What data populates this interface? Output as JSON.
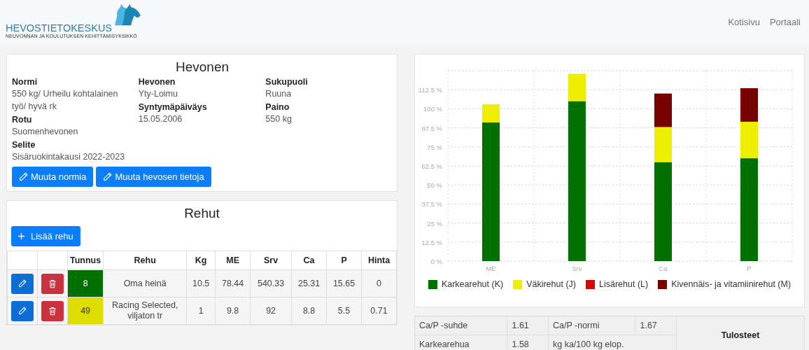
{
  "header": {
    "logo_title": "HEVOSTIETOKESKUS",
    "logo_subtitle": "NEUVONNAN JA KOULUTUKSEN KEHITTÄMISYKSIKKÖ",
    "nav": [
      "Kotisivu",
      "Portaali"
    ]
  },
  "horse": {
    "title": "Hevonen",
    "columns": [
      [
        {
          "label": "Normi",
          "value": "550 kg/ Urheilu kohtalainen työ/ hyvä rk"
        },
        {
          "label": "Rotu",
          "value": "Suomenhevonen"
        },
        {
          "label": "Selite",
          "value": "Sisäruokintakausi 2022-2023"
        }
      ],
      [
        {
          "label": "Hevonen",
          "value": "Yty-Loimu"
        },
        {
          "label": "Syntymäpäiväys",
          "value": "15.05.2006"
        }
      ],
      [
        {
          "label": "Sukupuoli",
          "value": "Ruuna"
        },
        {
          "label": "Paino",
          "value": "550 kg"
        }
      ]
    ],
    "buttons": [
      "Muuta normia",
      "Muuta hevosen tietoja"
    ]
  },
  "feeds": {
    "title": "Rehut",
    "add_button": "Lisää rehu",
    "columns": [
      "Tunnus",
      "Rehu",
      "Kg",
      "ME",
      "Srv",
      "Ca",
      "P",
      "Hinta"
    ],
    "rows": [
      {
        "color": "#007000",
        "cells": [
          "8",
          "Oma heinä",
          "10.5",
          "78.44",
          "540.33",
          "25.31",
          "15.65",
          "0"
        ]
      },
      {
        "color": "#dddd00",
        "cells": [
          "49",
          "Racing Selected, viljaton tr",
          "1",
          "9.8",
          "92",
          "8.8",
          "5.5",
          "0.71"
        ]
      }
    ]
  },
  "chart_data": {
    "type": "bar",
    "stacked": true,
    "grid": true,
    "categories": [
      "ME",
      "Srv",
      "Ca",
      "P"
    ],
    "ylim": [
      0,
      125
    ],
    "yticks": [
      {
        "value": 0,
        "label": "0 %"
      },
      {
        "value": 12.5,
        "label": "12.5 %"
      },
      {
        "value": 25,
        "label": "25 %"
      },
      {
        "value": 37.5,
        "label": "37.5 %"
      },
      {
        "value": 50,
        "label": "50 %"
      },
      {
        "value": 62.5,
        "label": "62.5 %"
      },
      {
        "value": 75,
        "label": "75 %"
      },
      {
        "value": 87.5,
        "label": "87.5 %"
      },
      {
        "value": 100,
        "label": "100 %"
      },
      {
        "value": 112.5,
        "label": "112.5 %"
      }
    ],
    "series": [
      {
        "name": "Karkearehut (K)",
        "color": "#007000",
        "values": [
          91,
          105,
          65,
          67.5
        ]
      },
      {
        "name": "Väkirehut (J)",
        "color": "#eeee00",
        "values": [
          12,
          18,
          23,
          24
        ]
      },
      {
        "name": "Lisärehut (L)",
        "color": "#dd0000",
        "values": [
          0,
          0,
          0,
          0
        ]
      },
      {
        "name": "Kivennäis- ja vitamiinirehut (M)",
        "color": "#760000",
        "values": [
          0,
          0,
          22,
          22
        ]
      }
    ]
  },
  "summary": {
    "rows": [
      {
        "cells": [
          {
            "text": "Ca/P -suhde"
          },
          {
            "text": "1.61"
          },
          {
            "text": "Ca/P -normi"
          },
          {
            "text": "1.67"
          }
        ]
      },
      {
        "cells": [
          {
            "text": "Karkearehua"
          },
          {
            "text": "1.58"
          },
          {
            "text": "kg ka/100 kg elop.",
            "colspan": 2
          }
        ]
      }
    ],
    "side": "Tulosteet"
  }
}
